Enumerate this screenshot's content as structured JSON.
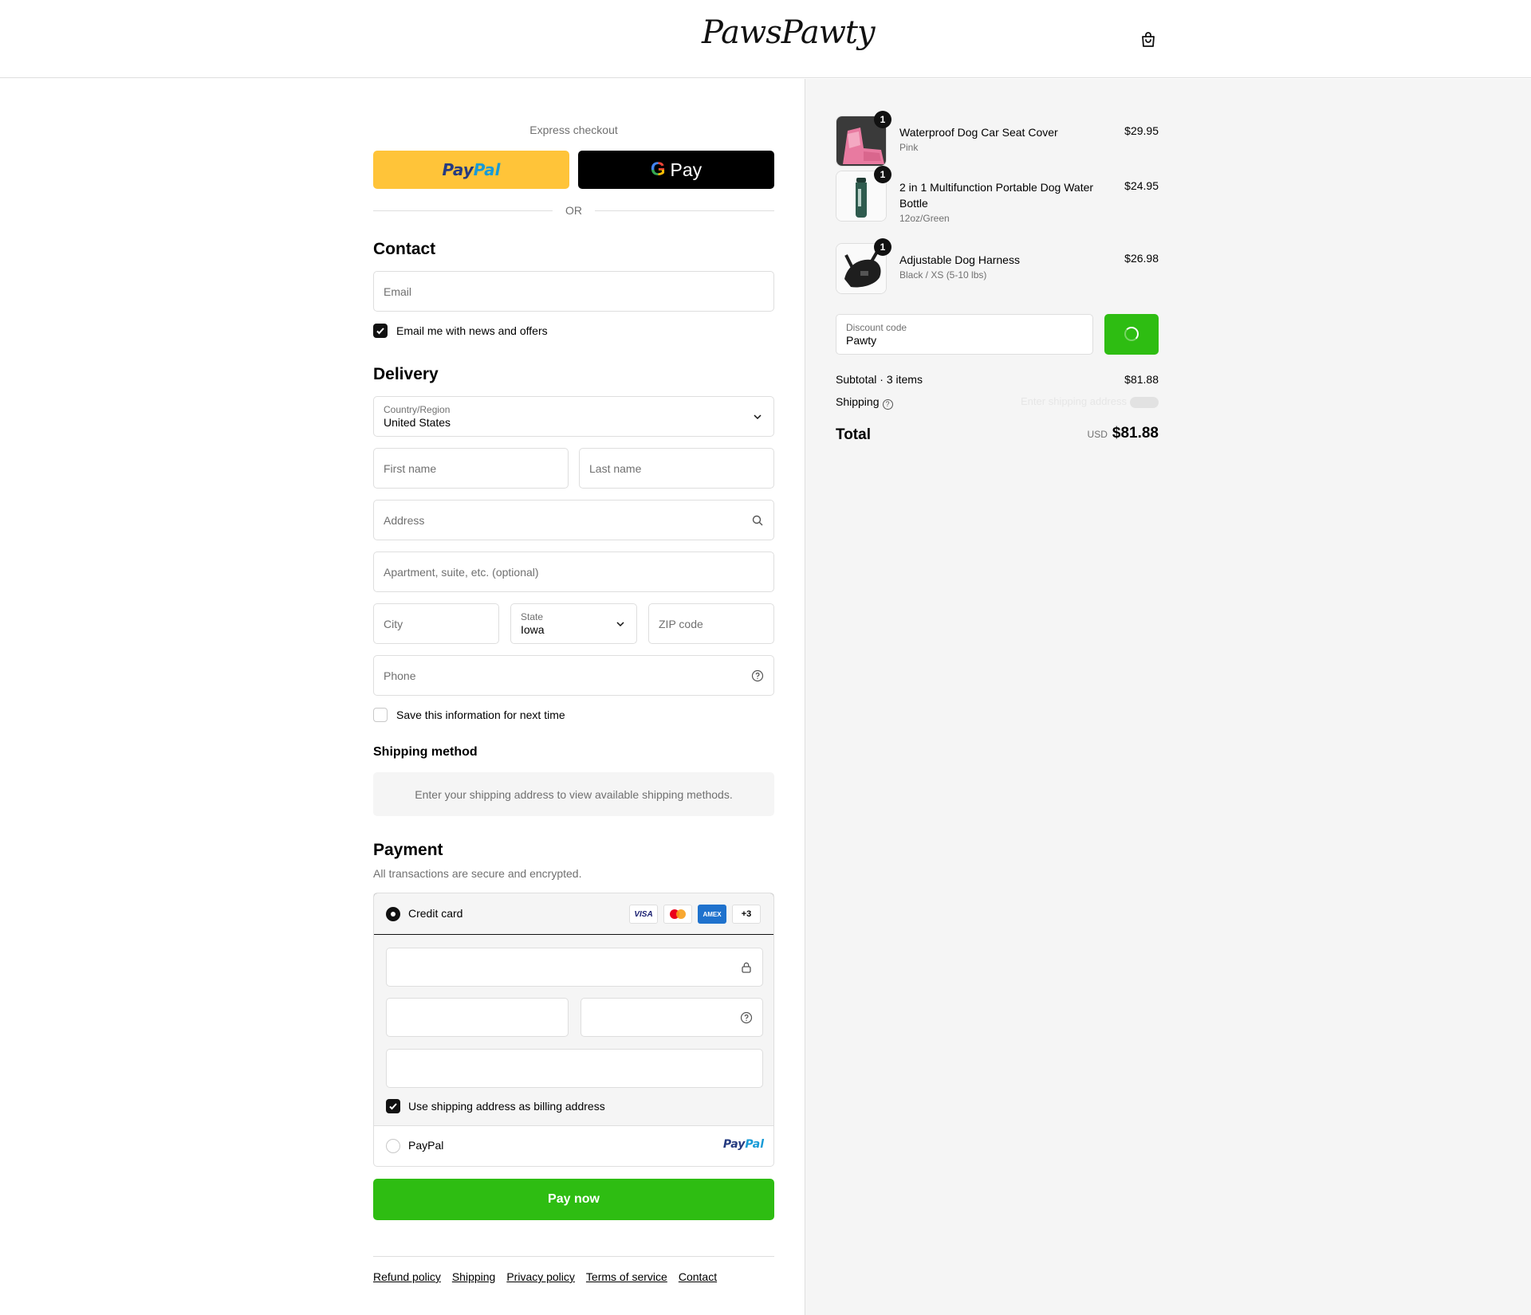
{
  "header": {
    "logo_text": "PawsPawty",
    "cart_icon": "shopping-bag-icon"
  },
  "express": {
    "title": "Express checkout",
    "paypal_pay": "Pay",
    "paypal_pal": "Pal",
    "gpay_g": "G",
    "gpay_label": "Pay",
    "or_label": "OR"
  },
  "contact": {
    "heading": "Contact",
    "email_placeholder": "Email",
    "email_value": "",
    "news_label": "Email me with news and offers",
    "news_checked": true
  },
  "delivery": {
    "heading": "Delivery",
    "country_label": "Country/Region",
    "country_value": "United States",
    "first_name_placeholder": "First name",
    "last_name_placeholder": "Last name",
    "address_placeholder": "Address",
    "apartment_placeholder": "Apartment, suite, etc. (optional)",
    "city_placeholder": "City",
    "state_label": "State",
    "state_value": "Iowa",
    "zip_placeholder": "ZIP code",
    "phone_placeholder": "Phone",
    "save_label": "Save this information for next time",
    "save_checked": false
  },
  "shipping_method": {
    "heading": "Shipping method",
    "message": "Enter your shipping address to view available shipping methods."
  },
  "payment": {
    "heading": "Payment",
    "subtitle": "All transactions are secure and encrypted.",
    "credit_card_label": "Credit card",
    "card_brands": [
      "VISA",
      "MC",
      "AMEX",
      "+3"
    ],
    "billing_label": "Use shipping address as billing address",
    "billing_checked": true,
    "paypal_label": "PayPal",
    "paypal_logo_pay": "Pay",
    "paypal_logo_pal": "Pal",
    "pay_now_label": "Pay now"
  },
  "footer": {
    "links": [
      "Refund policy",
      "Shipping",
      "Privacy policy",
      "Terms of service",
      "Contact"
    ]
  },
  "order": {
    "items": [
      {
        "name": "Waterproof Dog Car Seat Cover",
        "variant": "Pink",
        "price": "$29.95",
        "qty": "1"
      },
      {
        "name": "2 in 1 Multifunction Portable Dog Water Bottle",
        "variant": "12oz/Green",
        "price": "$24.95",
        "qty": "1"
      },
      {
        "name": "Adjustable Dog Harness",
        "variant": "Black / XS (5-10 lbs)",
        "price": "$26.98",
        "qty": "1"
      }
    ],
    "discount_label": "Discount code",
    "discount_value": "Pawty",
    "subtotal_label": "Subtotal · 3 items",
    "subtotal_value": "$81.88",
    "shipping_label": "Shipping",
    "shipping_pending": "Enter shipping address",
    "total_label": "Total",
    "total_currency": "USD",
    "total_value": "$81.88"
  },
  "colors": {
    "accent_green": "#2ebd12",
    "paypal_yellow": "#ffc439",
    "border": "#dedede",
    "muted_text": "#707070"
  }
}
